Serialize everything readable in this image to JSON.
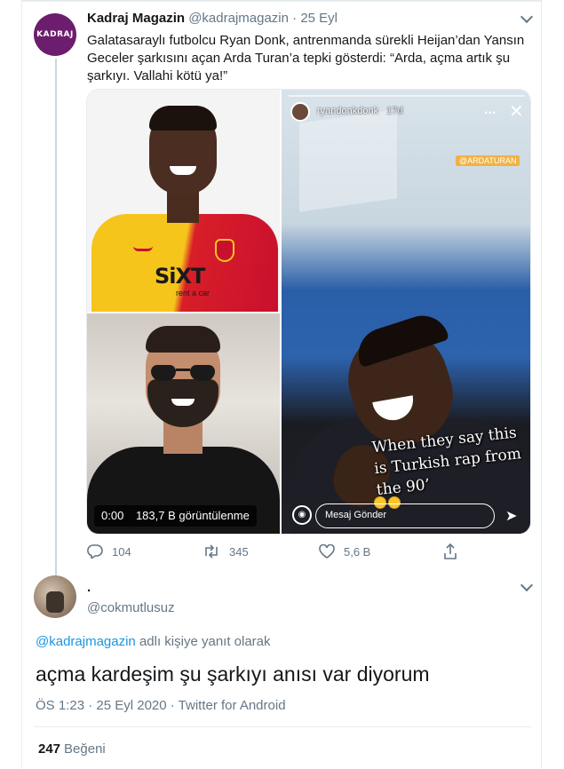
{
  "tweet": {
    "author_name": "Kadraj Magazin",
    "author_handle": "@kadrajmagazin",
    "separator": "·",
    "date": "25 Eyl",
    "avatar_logo": "KADRAJ",
    "text": "Galatasaraylı futbolcu Ryan Donk, antrenmanda sürekli Heijan’dan Yansın Geceler şarkısını açan Arda Turan’a tepki gösterdi: “Arda, açma artık şu şarkıyı. Vallahi kötü ya!”",
    "video": {
      "time": "0:00",
      "views": "183,7 B görüntülenme"
    },
    "story": {
      "username": "ryandonkdonk",
      "ago": "17d",
      "more": "...",
      "close": "✕",
      "tag": "@ARDATURAN",
      "caption": "When they say this is Turkish rap from the 90’",
      "message_placeholder": "Mesaj Gönder",
      "send_icon": "send-icon"
    },
    "actions": {
      "replies": "104",
      "retweets": "345",
      "likes": "5,6 B"
    }
  },
  "reply": {
    "author_name": ".",
    "author_handle": "@cokmutlusuz",
    "reply_to_mention": "@kadrajmagazin",
    "reply_to_suffix": " adlı kişiye yanıt olarak",
    "text": "açma kardeşim şu şarkıyı anısı var diyorum",
    "time": "ÖS 1:23 · 25 Eyl 2020 · Twitter for Android",
    "like_count": "247",
    "like_label": "Beğeni"
  },
  "colors": {
    "text": "#14171a",
    "secondary": "#657786",
    "link": "#1b95e0",
    "border": "#e6ecf0",
    "avatar_bg": "#6c1d6d"
  }
}
